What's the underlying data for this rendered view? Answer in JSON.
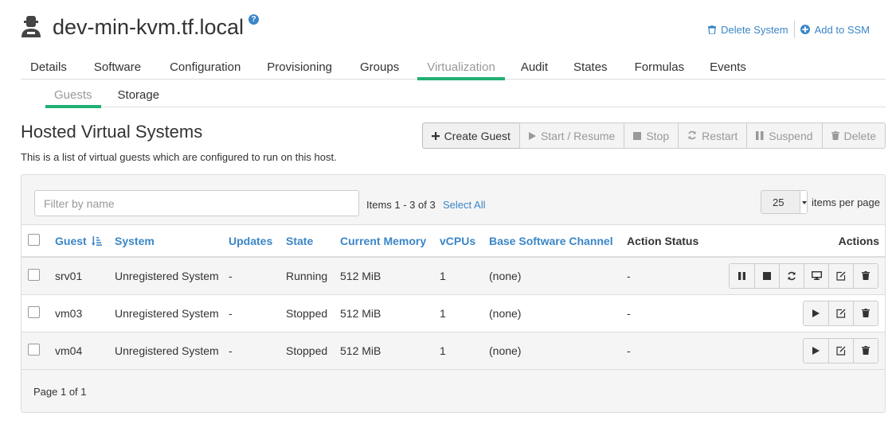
{
  "system": {
    "title": "dev-min-kvm.tf.local",
    "help": "?",
    "delete_label": "Delete System",
    "ssm_label": "Add to SSM"
  },
  "tabs": [
    {
      "label": "Details"
    },
    {
      "label": "Software"
    },
    {
      "label": "Configuration"
    },
    {
      "label": "Provisioning"
    },
    {
      "label": "Groups"
    },
    {
      "label": "Virtualization",
      "active": true
    },
    {
      "label": "Audit"
    },
    {
      "label": "States"
    },
    {
      "label": "Formulas"
    },
    {
      "label": "Events"
    }
  ],
  "subtabs": [
    {
      "label": "Guests",
      "active": true
    },
    {
      "label": "Storage"
    }
  ],
  "section": {
    "title": "Hosted Virtual Systems",
    "description": "This is a list of virtual guests which are configured to run on this host."
  },
  "toolbar": {
    "create": "Create Guest",
    "start": "Start / Resume",
    "stop": "Stop",
    "restart": "Restart",
    "suspend": "Suspend",
    "delete": "Delete"
  },
  "filter": {
    "placeholder": "Filter by name",
    "items_info": "Items 1 - 3 of 3",
    "select_all": "Select All",
    "per_page": "25",
    "per_page_label": "items per page"
  },
  "columns": {
    "guest": "Guest",
    "system": "System",
    "updates": "Updates",
    "state": "State",
    "memory": "Current Memory",
    "vcpus": "vCPUs",
    "channel": "Base Software Channel",
    "action_status": "Action Status",
    "actions": "Actions"
  },
  "rows": [
    {
      "guest": "srv01",
      "system": "Unregistered System",
      "updates": "-",
      "state": "Running",
      "memory": "512 MiB",
      "vcpus": "1",
      "channel": "(none)",
      "action_status": "-",
      "actions": [
        "pause-icon",
        "stop-icon",
        "refresh-icon",
        "monitor-icon",
        "edit-icon",
        "trash-icon"
      ]
    },
    {
      "guest": "vm03",
      "system": "Unregistered System",
      "updates": "-",
      "state": "Stopped",
      "memory": "512 MiB",
      "vcpus": "1",
      "channel": "(none)",
      "action_status": "-",
      "actions": [
        "play-icon",
        "edit-icon",
        "trash-icon"
      ]
    },
    {
      "guest": "vm04",
      "system": "Unregistered System",
      "updates": "-",
      "state": "Stopped",
      "memory": "512 MiB",
      "vcpus": "1",
      "channel": "(none)",
      "action_status": "-",
      "actions": [
        "play-icon",
        "edit-icon",
        "trash-icon"
      ]
    }
  ],
  "footer": {
    "page_info": "Page 1 of 1"
  },
  "colors": {
    "accent": "#21b073",
    "link": "#3b86c7"
  }
}
